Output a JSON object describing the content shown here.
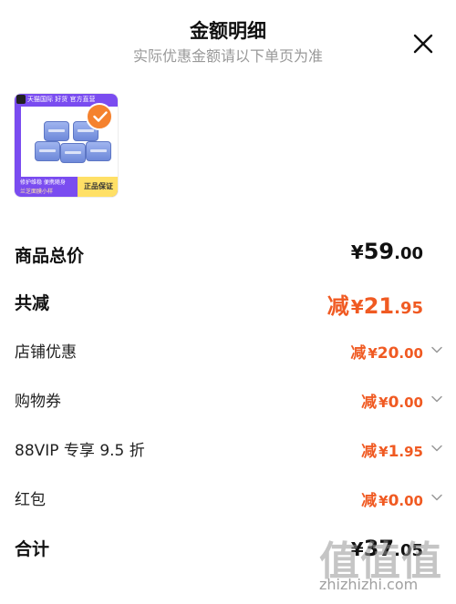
{
  "header": {
    "title": "金额明细",
    "subtitle": "实际优惠金额请以下单页为准",
    "close_icon": "close-icon"
  },
  "product": {
    "top_banner": "天猫国际 好货 官方直营",
    "bottom_line1": "修护维稳  便携随身",
    "bottom_line2": "兰芝面膜小样",
    "badge": "正品保证",
    "check_icon": "check-icon",
    "accent": "#7a4cf0"
  },
  "summary": [
    {
      "label": "商品总价",
      "prefix": "",
      "currency": "¥",
      "integer": "59",
      "decimal": ".00",
      "style": "total"
    },
    {
      "label": "共减",
      "prefix": "减",
      "currency": "¥",
      "integer": "21",
      "decimal": ".95",
      "style": "discount-total"
    },
    {
      "label": "店铺优惠",
      "prefix": "减",
      "currency": "¥",
      "integer": "20",
      "decimal": ".00",
      "style": "item"
    },
    {
      "label": "购物券",
      "prefix": "减",
      "currency": "¥",
      "integer": "0",
      "decimal": ".00",
      "style": "item"
    },
    {
      "label": "88VIP 专享 9.5 折",
      "prefix": "减",
      "currency": "¥",
      "integer": "1",
      "decimal": ".95",
      "style": "item"
    },
    {
      "label": "红包",
      "prefix": "减",
      "currency": "¥",
      "integer": "0",
      "decimal": ".00",
      "style": "item"
    },
    {
      "label": "合计",
      "prefix": "",
      "currency": "¥",
      "integer": "37",
      "decimal": ".05",
      "style": "total"
    }
  ],
  "watermark": {
    "big": "值值值",
    "small": "zhizhizhi.com"
  },
  "colors": {
    "discount": "#f05a22",
    "text": "#111111",
    "subtitle": "#999999"
  }
}
